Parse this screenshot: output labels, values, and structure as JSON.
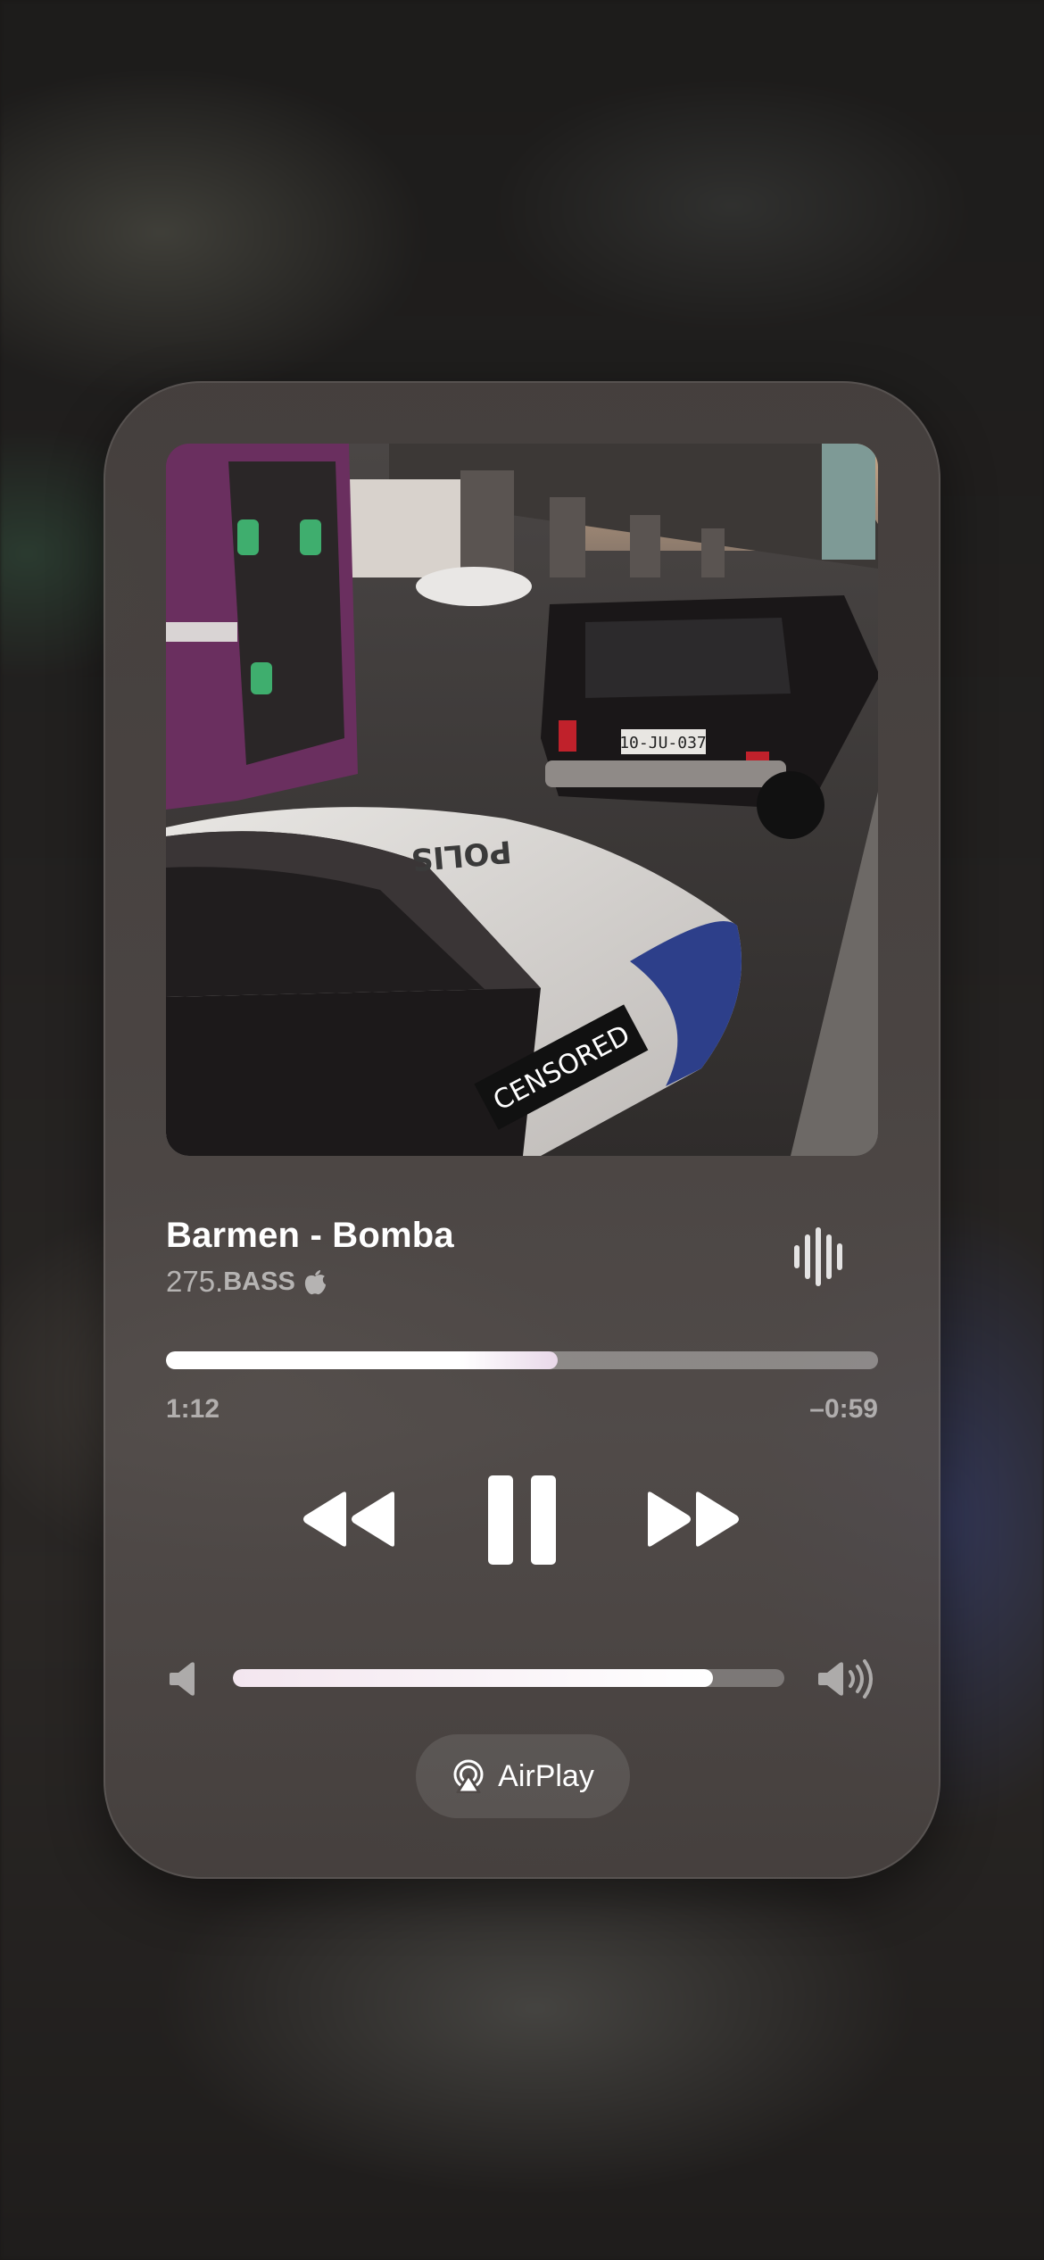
{
  "now_playing": {
    "title": "Barmen - Bomba",
    "artist_prefix": "275.",
    "artist_suffix": "BASS",
    "progress": 0.55,
    "time_elapsed": "1:12",
    "time_remaining": "–0:59",
    "volume": 0.87
  },
  "artwork": {
    "plate_text": "10-JU-037",
    "sticker_text": "CENSORED",
    "hood_text": "POLIS"
  },
  "airplay": {
    "label": "AirPlay"
  },
  "icons": {
    "waveform": "waveform-icon",
    "rewind": "rewind-icon",
    "pause": "pause-icon",
    "forward": "forward-icon",
    "volume_low": "speaker-low-icon",
    "volume_high": "speaker-high-icon",
    "airplay": "airplay-icon",
    "apple": "apple-logo-icon"
  },
  "colors": {
    "accent": "#ffffff",
    "secondary_text": "#9a9493"
  }
}
